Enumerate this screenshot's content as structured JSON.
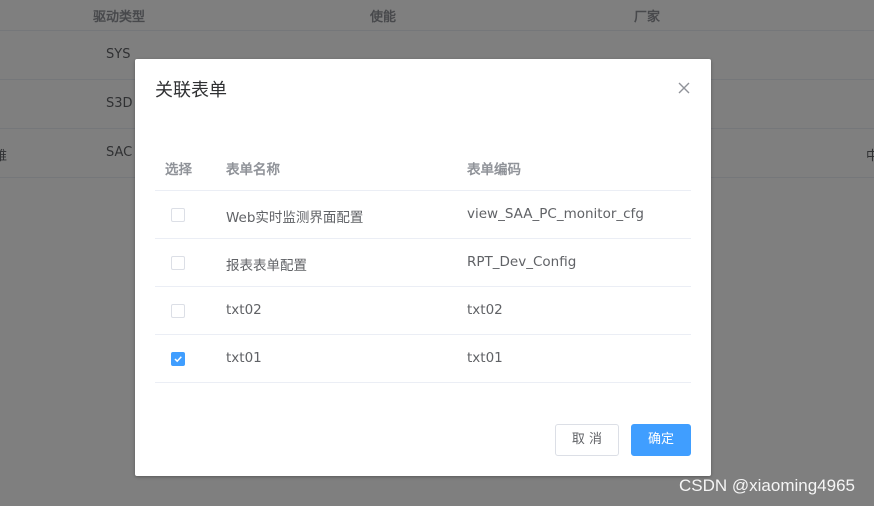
{
  "background_table": {
    "columns": [
      "驱动类型",
      "使能",
      "厂家"
    ],
    "rows": [
      {
        "prefix": "",
        "driver": "SYS"
      },
      {
        "prefix": "",
        "driver": "S3D"
      },
      {
        "prefix": "维",
        "driver": "SAC",
        "trailing": "中"
      }
    ]
  },
  "dialog": {
    "title": "关联表单",
    "close_icon": "close-icon",
    "table": {
      "headers": {
        "select": "选择",
        "name": "表单名称",
        "code": "表单编码"
      },
      "rows": [
        {
          "checked": false,
          "name": "Web实时监测界面配置",
          "code": "view_SAA_PC_monitor_cfg"
        },
        {
          "checked": false,
          "name": "报表表单配置",
          "code": "RPT_Dev_Config"
        },
        {
          "checked": false,
          "name": "txt02",
          "code": "txt02"
        },
        {
          "checked": true,
          "name": "txt01",
          "code": "txt01"
        }
      ]
    },
    "buttons": {
      "cancel": "取 消",
      "ok": "确定"
    }
  },
  "watermark": "CSDN @xiaoming4965",
  "colors": {
    "primary": "#409eff",
    "overlay": "rgba(0,0,0,0.5)",
    "text": "#606266",
    "header_text": "#909399"
  }
}
